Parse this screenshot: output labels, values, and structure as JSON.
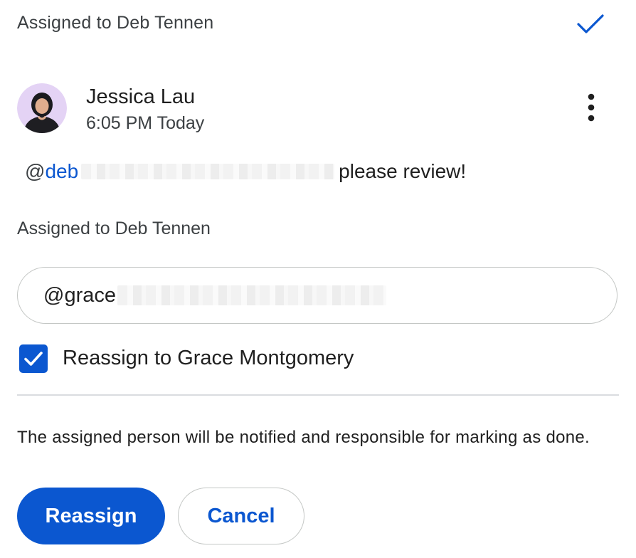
{
  "header": {
    "title": "Assigned to Deb Tennen"
  },
  "comment": {
    "author": "Jessica Lau",
    "timestamp": "6:05 PM Today",
    "mention_prefix": "@",
    "mention_name": "deb",
    "body_text": "please review!"
  },
  "assignment": {
    "label": "Assigned to Deb Tennen",
    "input_value": "@grace",
    "reassign_checkbox": {
      "checked": true,
      "label": "Reassign to Grace Montgomery"
    },
    "helper_text": "The assigned person will be notified and responsible for marking as done."
  },
  "actions": {
    "primary_label": "Reassign",
    "secondary_label": "Cancel"
  },
  "icons": {
    "resolve": "checkmark-icon",
    "more": "more-vert-icon",
    "checkbox": "checkbox-checked-icon"
  },
  "colors": {
    "accent": "#0b57d0",
    "text": "#1f1f1f",
    "secondary_text": "#3c4043",
    "border": "#c4c7c5",
    "divider": "#dadce0"
  }
}
